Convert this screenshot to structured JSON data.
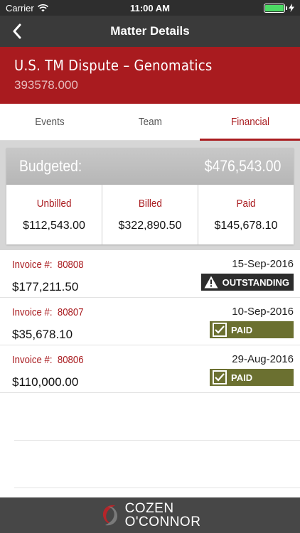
{
  "status_bar": {
    "carrier": "Carrier",
    "time": "11:00 AM",
    "battery_level": 1.0
  },
  "nav": {
    "title": "Matter Details",
    "back_icon": "chevron-left-icon"
  },
  "matter": {
    "title": "U.S. TM Dispute – Genomatics",
    "number": "393578.000"
  },
  "tabs": [
    {
      "label": "Events",
      "active": false
    },
    {
      "label": "Team",
      "active": false
    },
    {
      "label": "Financial",
      "active": true
    }
  ],
  "budget": {
    "label": "Budgeted:",
    "value": "$476,543.00",
    "columns": [
      {
        "label": "Unbilled",
        "value": "$112,543.00"
      },
      {
        "label": "Billed",
        "value": "$322,890.50"
      },
      {
        "label": "Paid",
        "value": "$145,678.10"
      }
    ]
  },
  "invoices": [
    {
      "label": "Invoice #:",
      "number": "80808",
      "date": "15-Sep-2016",
      "amount": "$177,211.50",
      "status": "OUTSTANDING"
    },
    {
      "label": "Invoice #:",
      "number": "80807",
      "date": "10-Sep-2016",
      "amount": "$35,678.10",
      "status": "PAID"
    },
    {
      "label": "Invoice #:",
      "number": "80806",
      "date": "29-Aug-2016",
      "amount": "$110,000.00",
      "status": "PAID"
    }
  ],
  "footer": {
    "logo_line1": "COZEN",
    "logo_line2": "O'CONNOR"
  },
  "colors": {
    "brand_red": "#a91b1f",
    "nav_dark": "#3a3a3a",
    "paid_green": "#6b7030",
    "outstanding_dark": "#2d2d2d",
    "footer": "#474747"
  }
}
